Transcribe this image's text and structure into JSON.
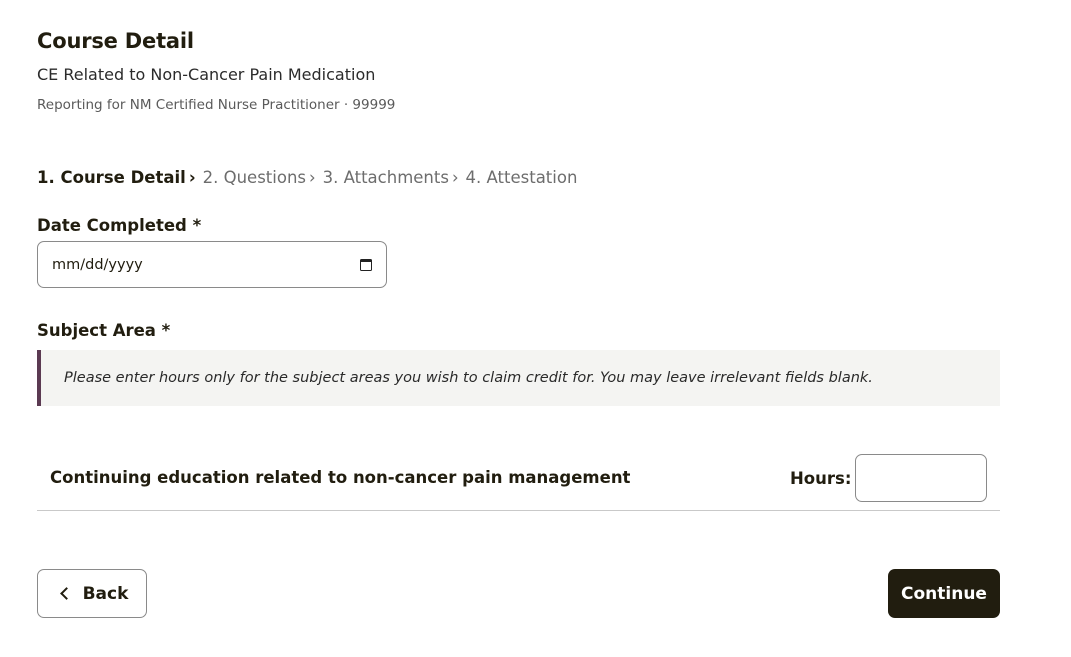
{
  "header": {
    "title": "Course Detail",
    "subtitle": "CE Related to Non-Cancer Pain Medication",
    "reporting": "Reporting for NM Certified Nurse Practitioner · 99999"
  },
  "steps": [
    {
      "label": "1. Course Detail",
      "separator": "›"
    },
    {
      "label": "2. Questions",
      "separator": "›"
    },
    {
      "label": "3. Attachments",
      "separator": "›"
    },
    {
      "label": "4. Attestation"
    }
  ],
  "form": {
    "date_label": "Date Completed *",
    "date_placeholder": "mm/dd/yyyy",
    "subject_label": "Subject Area *",
    "subject_note": "Please enter hours only for the subject areas you wish to claim credit for. You may leave irrelevant fields blank.",
    "subject_rows": [
      {
        "label": "Continuing education related to non-cancer pain management",
        "hours_label": "Hours:",
        "hours_value": ""
      }
    ]
  },
  "actions": {
    "back_label": "Back",
    "continue_label": "Continue"
  },
  "colors": {
    "primary": "#211d0f",
    "callout_accent": "#5b3a52",
    "callout_bg": "#f4f4f2"
  },
  "icons": {
    "calendar": "calendar-icon",
    "back": "chevron-left-icon"
  }
}
